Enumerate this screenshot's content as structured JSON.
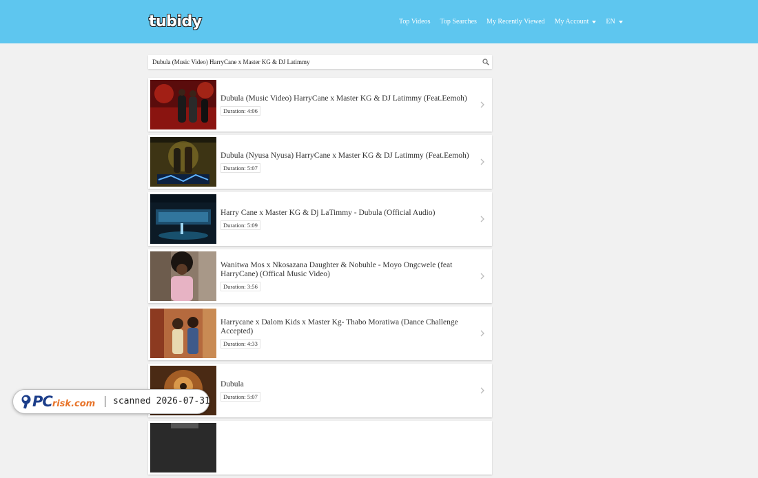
{
  "header": {
    "logo_text": "tubidy",
    "nav": [
      {
        "label": "Top Videos"
      },
      {
        "label": "Top Searches"
      },
      {
        "label": "My Recently Viewed"
      },
      {
        "label": "My Account"
      },
      {
        "label": "EN"
      }
    ],
    "brand_color": "#5ec6ef"
  },
  "search": {
    "value": "Dubula (Music Video) HarryCane x Master KG & DJ Latimmy"
  },
  "results": [
    {
      "title": "Dubula (Music Video) HarryCane x Master KG & DJ Latimmy (Feat.Eemoh)",
      "duration": "Duration: 4:06"
    },
    {
      "title": "Dubula (Nyusa Nyusa) HarryCane x Master KG & DJ Latimmy (Feat.Eemoh)",
      "duration": "Duration: 5:07"
    },
    {
      "title": "Harry Cane x Master KG & Dj LaTimmy - Dubula (Official Audio)",
      "duration": "Duration: 5:09"
    },
    {
      "title": "Wanitwa Mos x Nkosazana Daughter & Nobuhle - Moyo Ongcwele (feat HarryCane) (Offical Music Video)",
      "duration": "Duration: 3:56"
    },
    {
      "title": "Harrycane x Dalom Kids x Master Kg- Thabo Moratiwa (Dance Challenge Accepted)",
      "duration": "Duration: 4:33"
    },
    {
      "title": "Dubula",
      "duration": "Duration: 5:07"
    },
    {
      "title": "",
      "duration": ""
    }
  ],
  "watermark": {
    "logo_pc": "PC",
    "logo_risk": "risk.com",
    "text": "scanned 2026-07-31"
  }
}
